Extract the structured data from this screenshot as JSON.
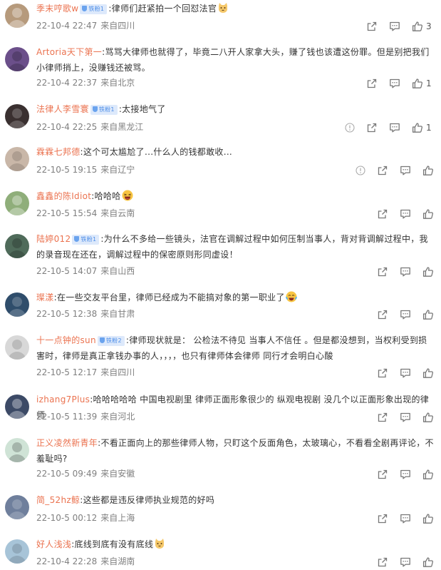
{
  "comments": [
    {
      "username": "季末哼歌w",
      "badge": "铁粉1",
      "text": ":律师们赶紧拍一个回怼法官",
      "emoji": "cat-emoji",
      "time": "22-10-4 22:47",
      "source": "来自四川",
      "likes": "3",
      "avatar_color": "#b69a7c"
    },
    {
      "username": "Artoria天下第一",
      "badge": "",
      "text": ":骂骂大律师也就得了，毕竟二八开人家拿大头，赚了钱也该遭这份罪。但是别把我们小律师捎上，没赚钱还被骂。",
      "emoji": "",
      "time": "22-10-4 22:37",
      "source": "来自北京",
      "likes": "1",
      "avatar_color": "#6b4f8a"
    },
    {
      "username": "法律人李雪寰",
      "badge": "铁粉1",
      "text": ":太接地气了",
      "emoji": "",
      "time": "22-10-4 22:25",
      "source": "来自黑龙江",
      "likes": "1",
      "avatar_color": "#3a3030"
    },
    {
      "username": "霖霖七邦德",
      "badge": "",
      "text": ":这个可太尴尬了...什么人的钱都敢收...",
      "emoji": "",
      "time": "22-10-5 19:15",
      "source": "来自辽宁",
      "likes": "",
      "avatar_color": "#c9b7a8"
    },
    {
      "username": "鑫鑫的陈Idiot",
      "badge": "",
      "text": ":哈哈哈",
      "emoji": "laugh-emoji",
      "time": "22-10-5 15:54",
      "source": "来自云南",
      "likes": "",
      "avatar_color": "#8fae7a"
    },
    {
      "username": "陆婷012",
      "badge": "铁粉1",
      "text": ":为什么不多给一些镜头，法官在调解过程中如何压制当事人，背对背调解过程中，我的录音现在还在，调解过程中的保密原则形同虚设！",
      "emoji": "",
      "time": "22-10-5 14:07",
      "source": "来自山西",
      "likes": "",
      "avatar_color": "#4f6b5a"
    },
    {
      "username": "璨漾",
      "badge": "",
      "text": ":在一些交友平台里，律师已经成为不能搞对象的第一职业了",
      "emoji": "tears-laugh-emoji",
      "time": "22-10-5 12:38",
      "source": "来自甘肃",
      "likes": "",
      "avatar_color": "#2f4d6b"
    },
    {
      "username": "十一点钟的sun",
      "badge": "铁粉2",
      "text": ":律师现状就是： 公检法不待见 当事人不信任 。但是都没想到，当权利受到损害时，律师是真正拿钱办事的人，，，，也只有律师体会律师 同行才会明白心酸",
      "emoji": "",
      "time": "22-10-5 12:17",
      "source": "来自四川",
      "likes": "",
      "avatar_color": "#d8d8d8"
    },
    {
      "username": "izhang7Plus",
      "badge": "",
      "text": ":哈哈哈哈哈 中国电视剧里 律师正面形象很少的 纵观电视剧 没几个以正面形象出现的律师",
      "emoji": "",
      "time": "22-10-5 11:39",
      "source": "来自河北",
      "likes": "",
      "avatar_color": "#3c4a66"
    },
    {
      "username": "正义凌然新青年",
      "badge": "",
      "text": ":不看正面向上的那些律师人物，只盯这个反面角色，太玻璃心，不看看全剧再评论，不羞耻吗?",
      "emoji": "",
      "time": "22-10-5 09:49",
      "source": "来自安徽",
      "likes": "",
      "avatar_color": "#cfe3d6"
    },
    {
      "username": "简_52hz鲸",
      "badge": "",
      "text": ":这些都是违反律师执业规范的好吗",
      "emoji": "",
      "time": "22-10-5 00:12",
      "source": "来自上海",
      "likes": "",
      "avatar_color": "#6f7f9c"
    },
    {
      "username": "好人浅浅",
      "badge": "",
      "text": ":底线到底有没有底线",
      "emoji": "cat-emoji",
      "time": "22-10-4 22:28",
      "source": "来自湖南",
      "likes": "",
      "avatar_color": "#a7c4d8"
    }
  ],
  "colors": {
    "username": "#eb7350",
    "meta": "#808080",
    "badge_bg": "#dde9fb",
    "badge_text": "#4d8ee8"
  },
  "icons": [
    "share-icon",
    "comment-icon",
    "like-icon",
    "report-icon"
  ]
}
